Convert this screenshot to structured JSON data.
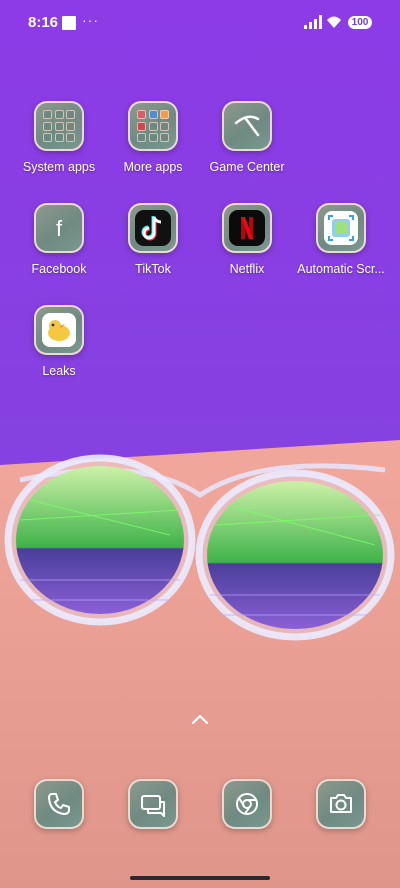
{
  "status_bar": {
    "time": "8:16",
    "battery": "100"
  },
  "apps": [
    {
      "label": "System apps",
      "icon": "folder-icon"
    },
    {
      "label": "More apps",
      "icon": "folder-icon"
    },
    {
      "label": "Game Center",
      "icon": "game-center-icon"
    },
    {
      "label": "Facebook",
      "icon": "facebook-icon"
    },
    {
      "label": "TikTok",
      "icon": "tiktok-icon"
    },
    {
      "label": "Netflix",
      "icon": "netflix-icon"
    },
    {
      "label": "Automatic Scr...",
      "icon": "screenshot-app-icon"
    },
    {
      "label": "Leaks",
      "icon": "leaks-icon"
    }
  ],
  "dock": [
    {
      "icon": "phone-icon"
    },
    {
      "icon": "messages-icon"
    },
    {
      "icon": "chrome-icon"
    },
    {
      "icon": "camera-icon"
    }
  ],
  "colors": {
    "wallpaper_top": "#8a3fe0",
    "wallpaper_bottom": "#e59a8a",
    "icon_tile": "#7a9088"
  }
}
